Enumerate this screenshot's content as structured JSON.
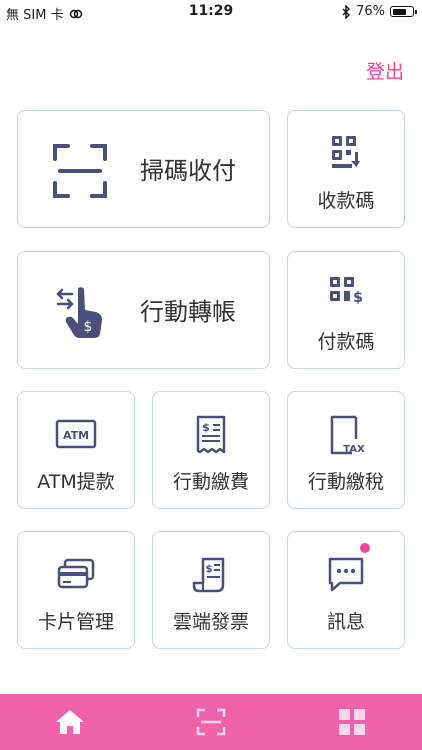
{
  "status_bar": {
    "carrier": "無 SIM 卡",
    "time": "11:29",
    "battery_percent": "76%",
    "battery_level": 0.76
  },
  "header": {
    "logout_label": "登出"
  },
  "menu": {
    "scan_pay": "掃碼收付",
    "receive_code": "收款碼",
    "mobile_transfer": "行動轉帳",
    "pay_code": "付款碼",
    "atm_withdraw": "ATM提款",
    "mobile_bill_pay": "行動繳費",
    "mobile_tax_pay": "行動繳稅",
    "card_management": "卡片管理",
    "cloud_invoice": "雲端發票",
    "messages": "訊息"
  },
  "icon_text": {
    "atm": "ATM",
    "tax": "TAX",
    "dollar": "$"
  },
  "colors": {
    "accent_pink": "#ec4899",
    "tab_bar": "#f062aa",
    "icon_navy": "#4a4f7c",
    "tile_border": "#c8d4e6"
  },
  "tab_bar": {
    "items": [
      "home-icon",
      "scan-icon",
      "grid-icon"
    ]
  }
}
